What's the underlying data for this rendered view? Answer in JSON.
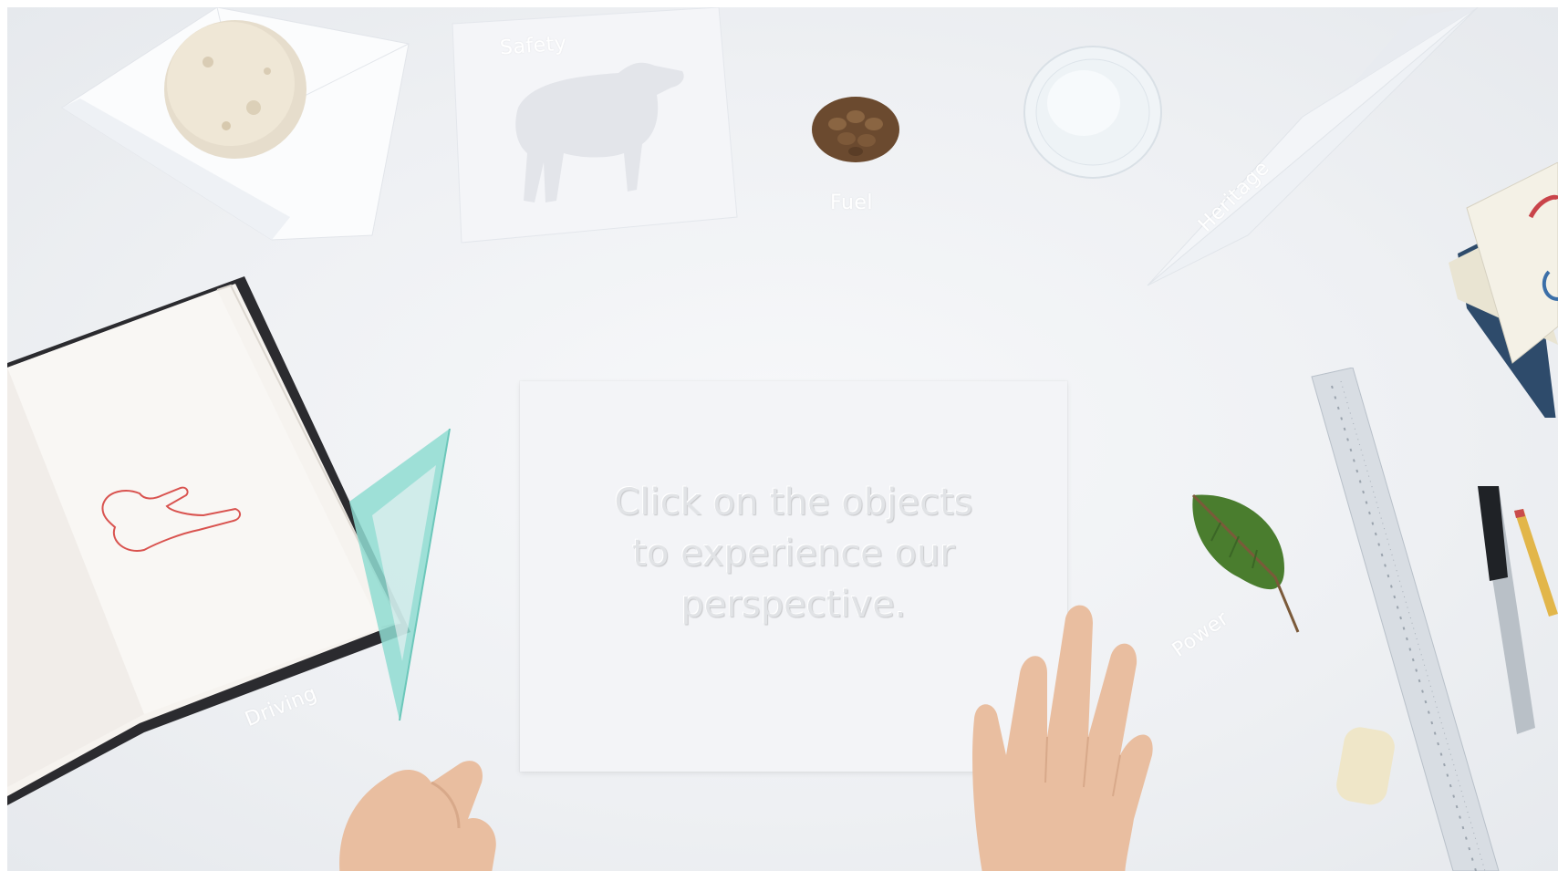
{
  "scene": {
    "card_lines": [
      "Click on the objects",
      "to experience our",
      "perspective."
    ]
  },
  "objects": {
    "safety": {
      "label": "Safety",
      "icon": "moose-cutout-card-icon"
    },
    "fuel": {
      "label": "Fuel",
      "icon": "pinecone-icon"
    },
    "heritage": {
      "label": "Heritage",
      "icon": "paper-airplane-icon"
    },
    "driving": {
      "label": "Driving",
      "icon": "sketchbook-icon"
    },
    "power": {
      "label": "Power",
      "icon": "leaf-icon"
    }
  },
  "colors": {
    "desk": "#eef0f3",
    "card_text": "#e1e3e6",
    "label_text": "#ffffff",
    "sketch_red": "#d9534f",
    "triangle_teal": "#7fd6cc",
    "leaf_green": "#4a7d2e"
  }
}
